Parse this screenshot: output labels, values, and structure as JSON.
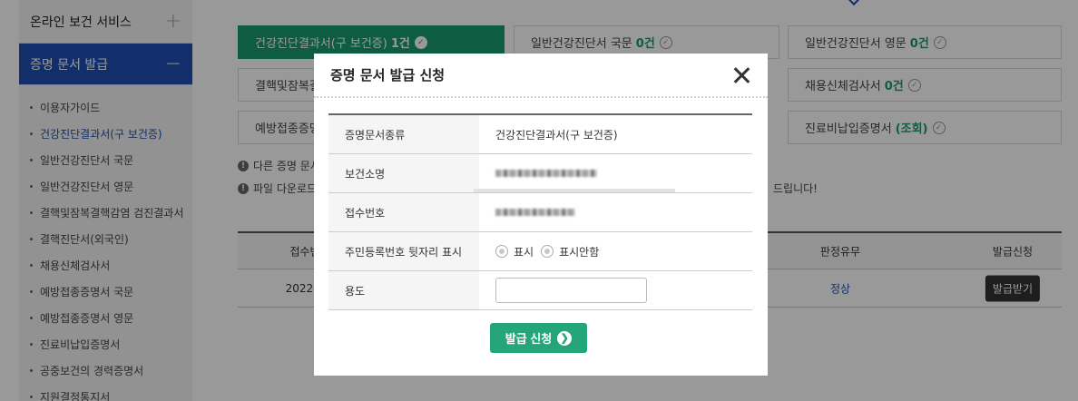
{
  "sidebar": {
    "sections": [
      {
        "label": "온라인 보건 서비스",
        "toggle": "+"
      },
      {
        "label": "증명 문서 발급",
        "toggle": "−"
      }
    ],
    "items": [
      "이용자가이드",
      "건강진단결과서(구 보건증)",
      "일반건강진단서 국문",
      "일반건강진단서 영문",
      "결핵및잠복결핵감염 검진결과서",
      "결핵진단서(외국인)",
      "채용신체검사서",
      "예방접종증명서 국문",
      "예방접종증명서 영문",
      "진료비납입증명서",
      "공중보건의 경력증명서",
      "지원결정통지서"
    ],
    "current_index": 1
  },
  "tabs": [
    {
      "label": "건강진단결과서(구 보건증)",
      "count": "1건"
    },
    {
      "label": "일반건강진단서 국문",
      "count": "0건"
    },
    {
      "label": "일반건강진단서 영문",
      "count": "0건"
    },
    {
      "label": "결핵및잠복결",
      "count": ""
    },
    {
      "label": "채용신체검사서",
      "count": "0건"
    },
    {
      "label": "예방접종증명",
      "count": ""
    },
    {
      "label": "진료비납입증명서",
      "count": "(조회)"
    }
  ],
  "notes": [
    "다른 증명 문서",
    "파일 다운로드"
  ],
  "note_tail": "드립니다!",
  "table": {
    "headers": [
      "접수번",
      "판정유무",
      "발급신청"
    ],
    "row": {
      "date": "2022-",
      "status": "정상",
      "action": "발급받기"
    }
  },
  "modal": {
    "title": "증명 문서 발급 신청",
    "fields": {
      "doc_type_label": "증명문서종류",
      "doc_type_value": "건강진단결과서(구 보건증)",
      "clinic_label": "보건소명",
      "receipt_label": "접수번호",
      "rrn_label": "주민등록번호 뒷자리 표시",
      "rrn_opt_show": "표시",
      "rrn_opt_hide": "표시안함",
      "purpose_label": "용도",
      "purpose_value": ""
    },
    "submit_label": "발급 신청"
  },
  "colors": {
    "green": "#189a6d",
    "blue": "#1f4fb2",
    "dark": "#333333"
  },
  "icons": {
    "close": "close-icon",
    "submit_arrow": "chevron-right-icon",
    "check": "check-circle-icon"
  }
}
